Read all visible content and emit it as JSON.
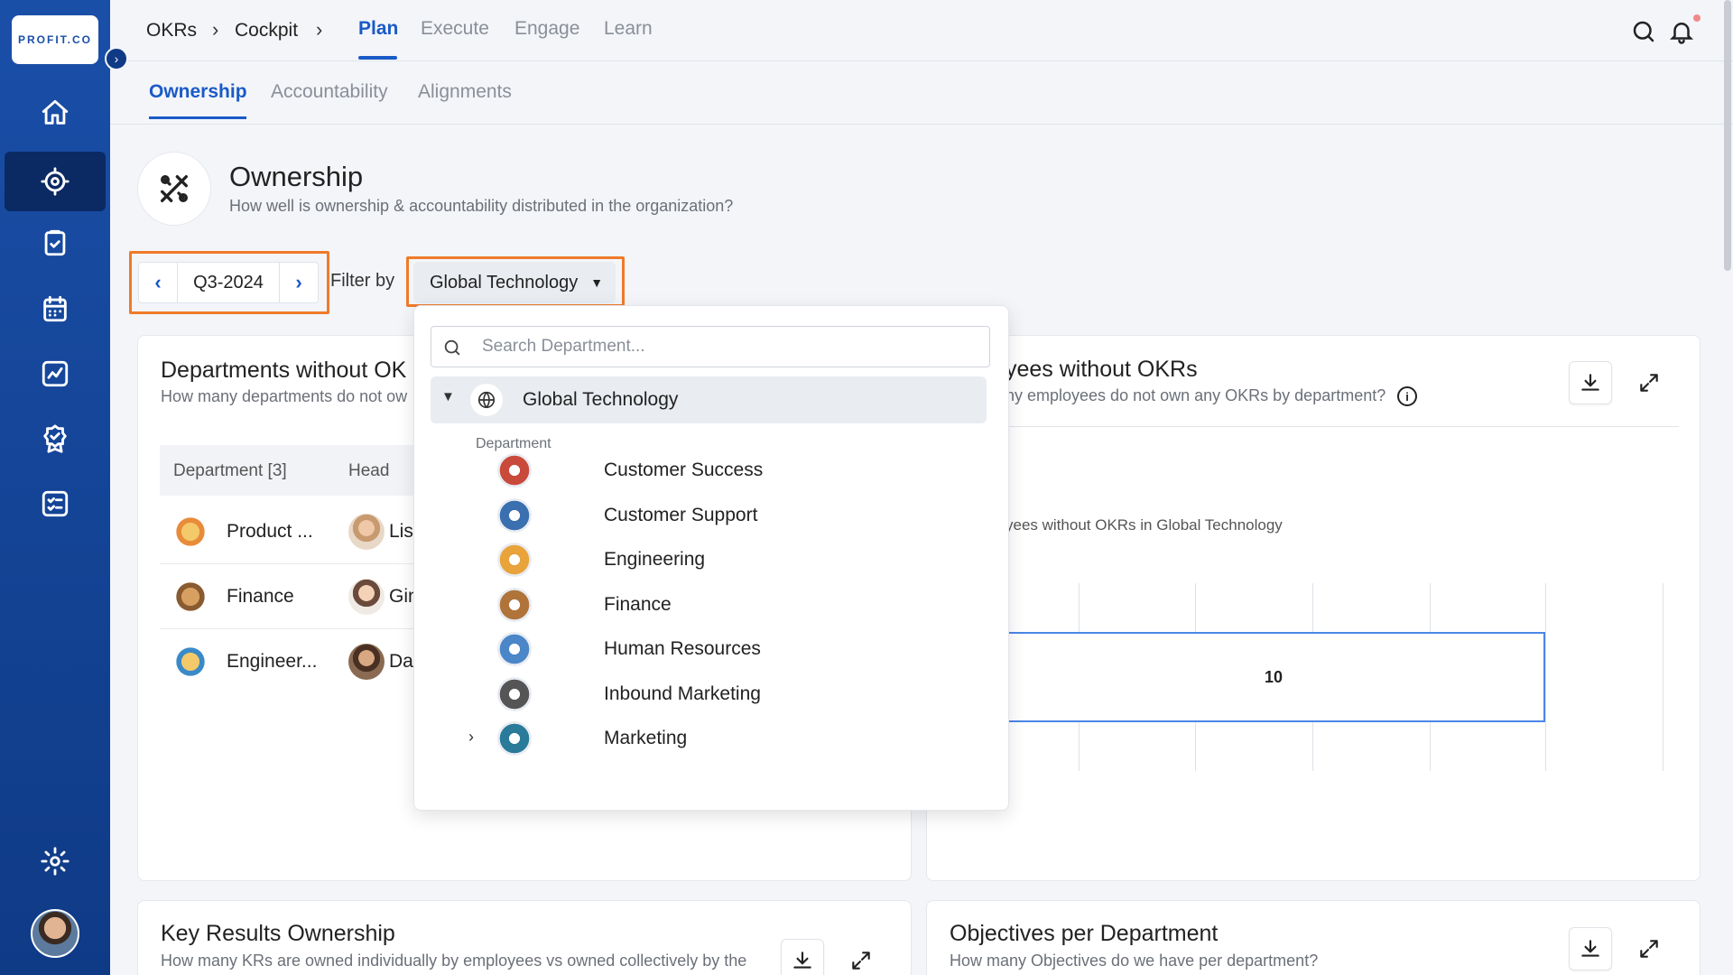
{
  "app": {
    "logo_text": "PROFIT.CO"
  },
  "sidebar": {
    "items": [
      {
        "name": "home"
      },
      {
        "name": "okrs",
        "active": true
      },
      {
        "name": "tasks"
      },
      {
        "name": "calendar"
      },
      {
        "name": "analytics"
      },
      {
        "name": "rewards"
      },
      {
        "name": "checklists"
      }
    ]
  },
  "topbar": {
    "breadcrumb": [
      "OKRs",
      "Cockpit"
    ],
    "tabs": [
      "Plan",
      "Execute",
      "Engage",
      "Learn"
    ],
    "active_tab": "Plan"
  },
  "subtabs": {
    "items": [
      "Ownership",
      "Accountability",
      "Alignments"
    ],
    "active": "Ownership"
  },
  "page": {
    "title": "Ownership",
    "subtitle": "How well is ownership & accountability distributed in the organization?"
  },
  "period": {
    "value": "Q3-2024"
  },
  "filter": {
    "label": "Filter by",
    "value": "Global Technology"
  },
  "dropdown": {
    "search_placeholder": "Search Department...",
    "root": "Global Technology",
    "section_label": "Department",
    "items": [
      {
        "label": "Customer Success",
        "color": "#c94a3a"
      },
      {
        "label": "Customer Support",
        "color": "#3a6fb0"
      },
      {
        "label": "Engineering",
        "color": "#e8a33a"
      },
      {
        "label": "Finance",
        "color": "#b0743a"
      },
      {
        "label": "Human Resources",
        "color": "#4a86c8"
      },
      {
        "label": "Inbound Marketing",
        "color": "#555555"
      },
      {
        "label": "Marketing",
        "color": "#2a7a9a",
        "expandable": true
      }
    ]
  },
  "card_departments": {
    "title": "Departments without OK",
    "subtitle": "How many departments do not ow",
    "columns": [
      "Department [3]",
      "Head"
    ],
    "rows": [
      {
        "dept": "Product ...",
        "head": "Lis"
      },
      {
        "dept": "Finance",
        "head": "Gin"
      },
      {
        "dept": "Engineer...",
        "head": "Dav"
      }
    ]
  },
  "card_employees": {
    "title": "yees without OKRs",
    "subtitle": "ny employees do not own any OKRs by department?",
    "chart_data": {
      "type": "bar",
      "title": "yees without OKRs in Global Technology",
      "values": [
        10
      ]
    }
  },
  "card_kr": {
    "title": "Key Results Ownership",
    "subtitle": "How many KRs are owned individually by employees vs owned collectively by the"
  },
  "card_objectives": {
    "title": "Objectives per Department",
    "subtitle": "How many Objectives do we have per department?"
  }
}
